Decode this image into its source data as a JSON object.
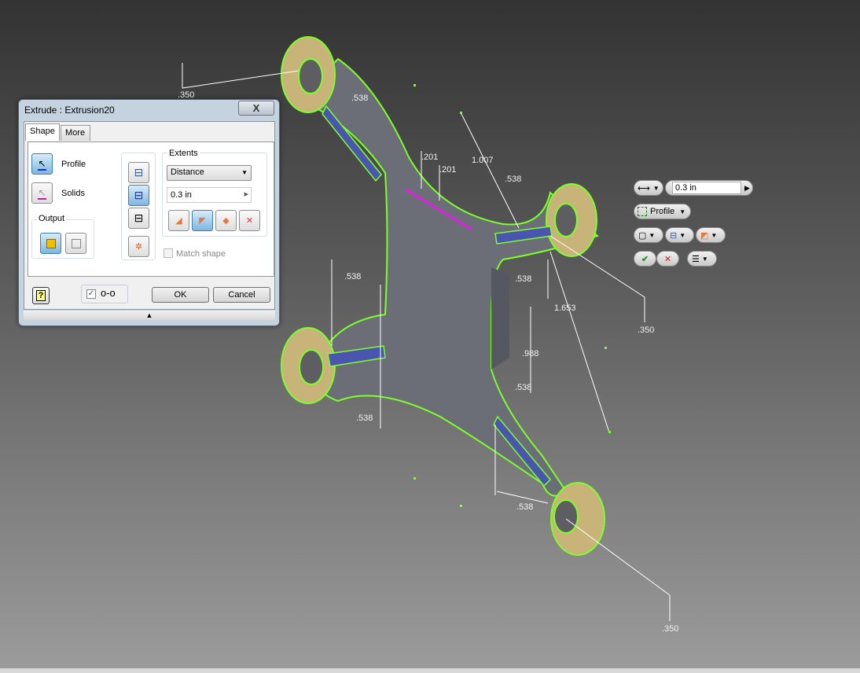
{
  "viewport": {
    "dimensions": [
      ".350",
      ".538",
      ".201",
      ".201",
      "1.007",
      ".538",
      ".538",
      ".538",
      "1.653",
      ".350",
      ".988",
      ".538",
      ".538",
      ".538",
      ".350"
    ]
  },
  "dialog": {
    "title": "Extrude : Extrusion20",
    "close_label": "X",
    "tabs": [
      {
        "label": "Shape",
        "active": true
      },
      {
        "label": "More",
        "active": false
      }
    ],
    "profile_label": "Profile",
    "solids_label": "Solids",
    "output_label": "Output",
    "extents_label": "Extents",
    "extents_value": "Distance",
    "distance_value": "0.3 in",
    "match_shape_label": "Match shape",
    "match_shape_checked": false,
    "preview_checked": true,
    "ok_label": "OK",
    "cancel_label": "Cancel"
  },
  "mini_toolbar": {
    "distance_value": "0.3 in",
    "profile_label": "Profile"
  },
  "colors": {
    "profile_outline": "#7cff2a",
    "slot": "#4a55b0",
    "boss": "#c8b478",
    "ok_check": "#1a9a1a",
    "cancel_x": "#d02020"
  }
}
